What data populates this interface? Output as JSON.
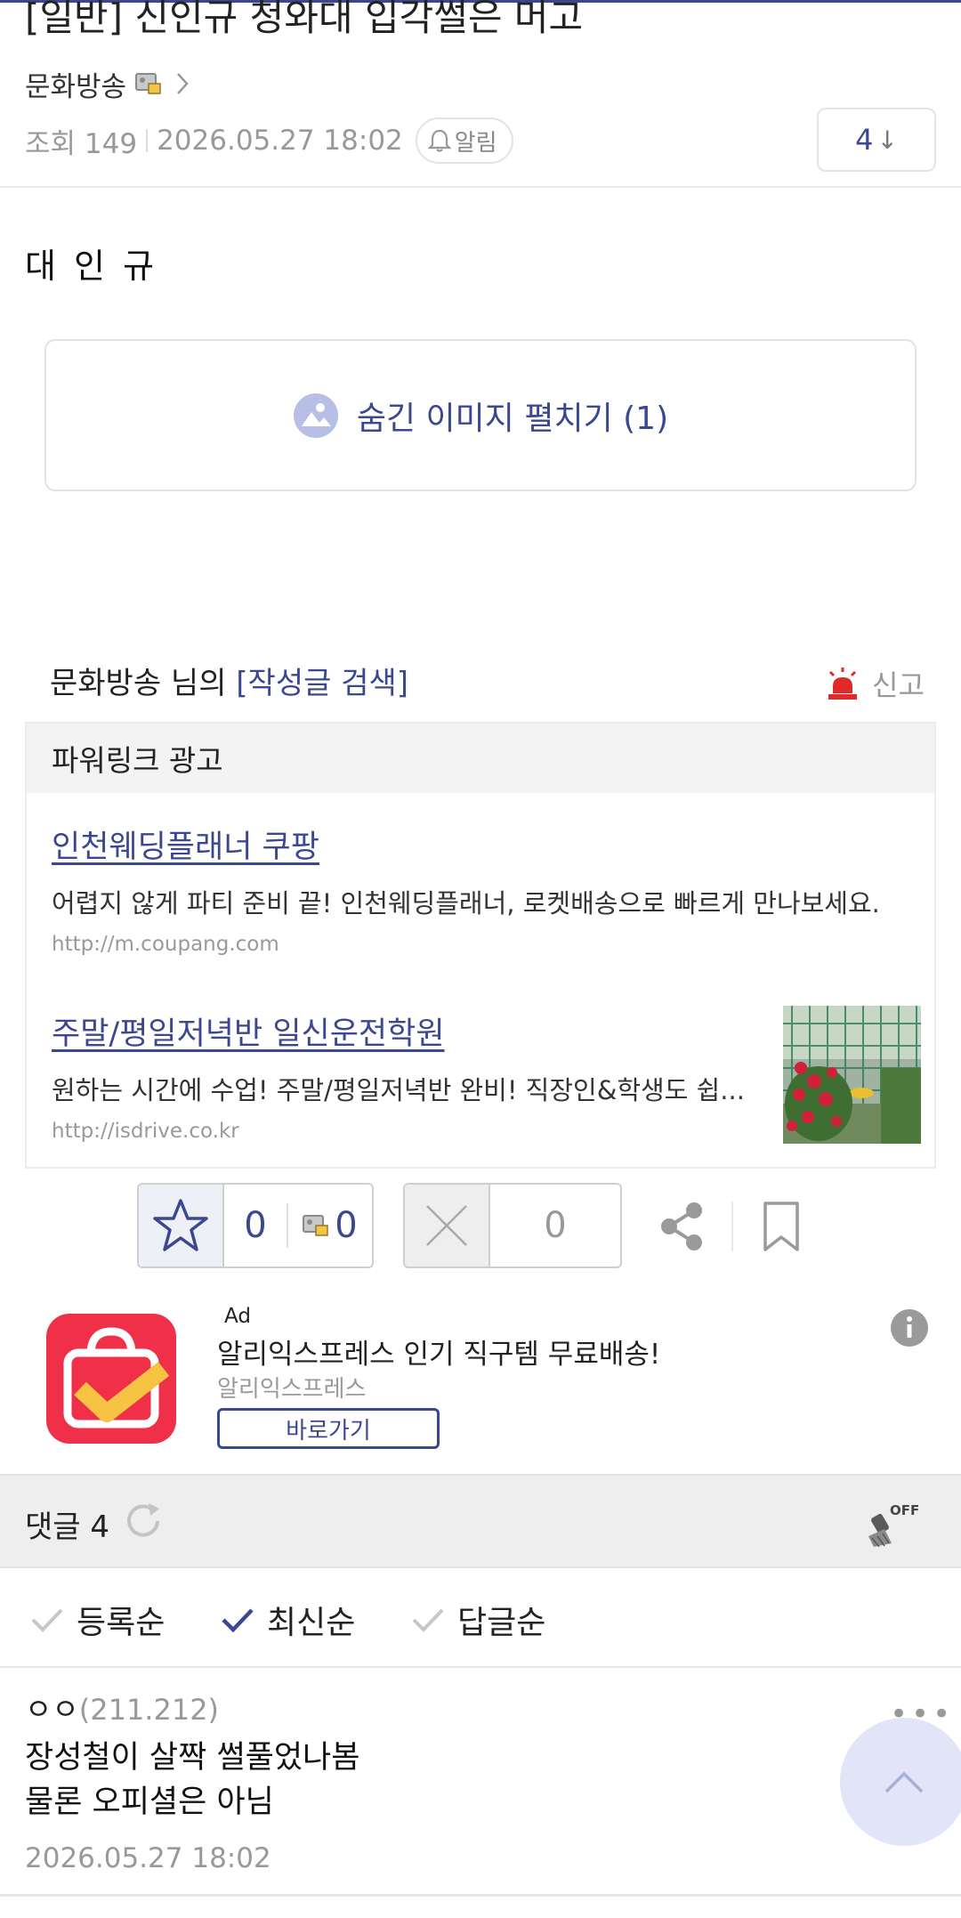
{
  "post": {
    "title": "[일반] 신인규 청와대 입각썰은 머고",
    "author": "문화방송",
    "views_label": "조회 149",
    "datetime": "2026.05.27 18:02",
    "alarm_label": "알림",
    "comment_jump_count": "4",
    "comment_jump_arrow": "↓",
    "body_text": "대 인 규",
    "hidden_image_label": "숨긴 이미지 펼치기 (1)"
  },
  "writer_bar": {
    "writer_suffix": "문화방송 님의 ",
    "search_link": "[작성글 검색]",
    "report_label": "신고"
  },
  "powerlink": {
    "header": "파워링크 광고",
    "items": [
      {
        "title": "인천웨딩플래너 쿠팡",
        "desc": "어렵지 않게 파티 준비 끝! 인천웨딩플래너, 로켓배송으로 빠르게 만나보세요.",
        "url": "http://m.coupang.com"
      },
      {
        "title": "주말/평일저녁반 일신운전학원",
        "desc": "원하는 시간에 수업! 주말/평일저녁반 완비! 직장인&학생도 쉽...",
        "url": "http://isdrive.co.kr"
      }
    ]
  },
  "votes": {
    "up_count": "0",
    "fix_count": "0",
    "down_count": "0"
  },
  "app_ad": {
    "badge": "Ad",
    "title": "알리익스프레스 인기 직구템 무료배송!",
    "advertiser": "알리익스프레스",
    "button": "바로가기"
  },
  "comments": {
    "label": "댓글 4",
    "clean_off_label": "OFF",
    "sort_options": [
      "등록순",
      "최신순",
      "답글순"
    ],
    "selected_sort": "최신순",
    "items": [
      {
        "nickname": "ㅇㅇ",
        "ip": "(211.212)",
        "text": "장성철이 살짝 썰풀었나봄\n물론 오피셜은 아님",
        "date": "2026.05.27 18:02",
        "more": "•••"
      }
    ]
  },
  "colors": {
    "accent": "#3b4890",
    "report_red": "#e02a2a",
    "app_icon_red": "#f03048",
    "app_icon_yellow": "#f6c343"
  }
}
